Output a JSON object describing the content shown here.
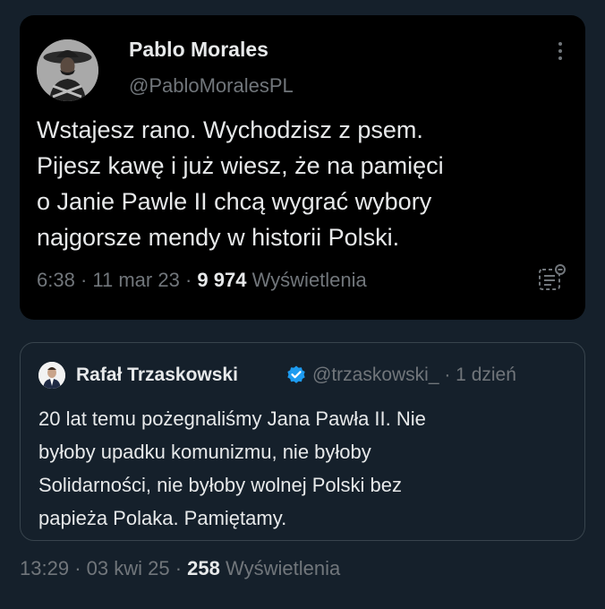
{
  "tweet": {
    "author_name": "Pablo Morales",
    "author_handle": "@PabloMoralesPL",
    "text_lines": [
      "Wstajesz rano. Wychodzisz z psem.",
      "Pijesz kawę i już wiesz, że na pamięci",
      "o Janie Pawle II chcą wygrać wybory",
      "najgorsze mendy w historii Polski."
    ],
    "time": "6:38",
    "date": "11 mar 23",
    "views": "9 974",
    "views_label": "Wyświetlenia",
    "more_icon": "more-dots-icon",
    "stats_icon": "view-stats-icon"
  },
  "quote": {
    "author_name": "Rafał Trzaskowski",
    "verified_icon": "verified-badge-icon",
    "verified_color": "#1d9bf0",
    "author_handle": "@trzaskowski_",
    "age": "· 1 dzień",
    "text_lines": [
      "20 lat temu pożegnaliśmy Jana Pawła II. Nie",
      "byłoby upadku komunizmu, nie byłoby",
      "Solidarności, nie byłoby wolnej Polski bez",
      "papieża Polaka. Pamiętamy."
    ]
  },
  "post_meta": {
    "time": "13:29",
    "date": "03 kwi 25",
    "views": "258",
    "views_label": "Wyświetlenia"
  },
  "colors": {
    "background": "#15202b",
    "card": "#000000",
    "text": "#e7e9ea",
    "muted": "#71767b",
    "border": "#38444d"
  }
}
